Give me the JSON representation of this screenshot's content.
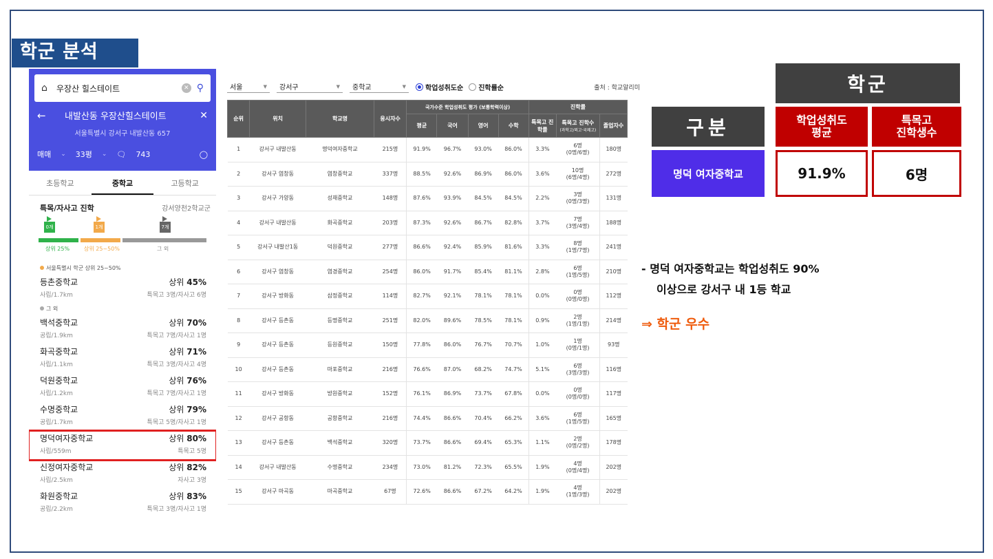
{
  "slide": {
    "title": "학군 분석"
  },
  "app": {
    "search": {
      "query": "우장산 힐스테이트"
    },
    "header": {
      "name": "내발산동 우장산힐스테이트",
      "address": "서울특별시 강서구 내발산동 657"
    },
    "meta": {
      "deal": "매매",
      "size": "33평",
      "comments": "743"
    },
    "tabs": [
      "초등학교",
      "중학교",
      "고등학교"
    ],
    "special": {
      "title": "특목/자사고 진학",
      "right": "강서양천2학교군"
    },
    "flags": [
      {
        "label": "0개",
        "color": "#2fb24a"
      },
      {
        "label": "1개",
        "color": "#f2a94a"
      },
      {
        "label": "7개",
        "color": "#666666"
      }
    ],
    "bar_labels": [
      "상위 25%",
      "상위 25~50%",
      "그 외"
    ],
    "bar_fractions": [
      0.22,
      0.22,
      0.56
    ],
    "group1_caption": "서울특별시 학군 상위 25~50%",
    "group2_caption": "그 외",
    "schools_group1": [
      {
        "name": "등촌중학교",
        "rank_prefix": "상위 ",
        "rank": "45%",
        "sub": "사립/1.7km",
        "sub2": "특목고 3명/자사고 6명"
      }
    ],
    "schools_group2": [
      {
        "name": "백석중학교",
        "rank_prefix": "상위 ",
        "rank": "70%",
        "sub": "공립/1.9km",
        "sub2": "특목고 7명/자사고 1명"
      },
      {
        "name": "화곡중학교",
        "rank_prefix": "상위 ",
        "rank": "71%",
        "sub": "사립/1.1km",
        "sub2": "특목고 3명/자사고 4명"
      },
      {
        "name": "덕원중학교",
        "rank_prefix": "상위 ",
        "rank": "76%",
        "sub": "사립/1.2km",
        "sub2": "특목고 7명/자사고 1명"
      },
      {
        "name": "수명중학교",
        "rank_prefix": "상위 ",
        "rank": "79%",
        "sub": "공립/1.7km",
        "sub2": "특목고 5명/자사고 1명"
      },
      {
        "name": "명덕여자중학교",
        "rank_prefix": "상위 ",
        "rank": "80%",
        "sub": "사립/559m",
        "sub2": "특목고 5명",
        "highlight": true
      },
      {
        "name": "신정여자중학교",
        "rank_prefix": "상위 ",
        "rank": "82%",
        "sub": "사립/2.5km",
        "sub2": "자사고 3명"
      },
      {
        "name": "화원중학교",
        "rank_prefix": "상위 ",
        "rank": "83%",
        "sub": "공립/2.2km",
        "sub2": "특목고 3명/자사고 1명"
      }
    ]
  },
  "filters": {
    "city": "서울",
    "district": "강서구",
    "level": "중학교",
    "sort1": "학업성취도순",
    "sort2": "진학률순",
    "source": "출처 : 학교알리미"
  },
  "table": {
    "header_top": [
      "순위",
      "위치",
      "학교명",
      "응시자수",
      "국가수준 학업성취도 평가 (보통학력이상)",
      "진학률"
    ],
    "header_sub": [
      "평균",
      "국어",
      "영어",
      "수학",
      "특목고 진학률",
      "특목고 진학수",
      "(과학고/외고·국제고)",
      "졸업자수"
    ],
    "rows": [
      [
        "1",
        "강서구 내발산동",
        "명덕여자중학교",
        "215명",
        "91.9%",
        "96.7%",
        "93.0%",
        "86.0%",
        "3.3%",
        "6명",
        "(0명/6명)",
        "180명"
      ],
      [
        "2",
        "강서구 염창동",
        "염창중학교",
        "337명",
        "88.5%",
        "92.6%",
        "86.9%",
        "86.0%",
        "3.6%",
        "10명",
        "(6명/4명)",
        "272명"
      ],
      [
        "3",
        "강서구 가양동",
        "성재중학교",
        "148명",
        "87.6%",
        "93.9%",
        "84.5%",
        "84.5%",
        "2.2%",
        "3명",
        "(0명/3명)",
        "131명"
      ],
      [
        "4",
        "강서구 내발산동",
        "화곡중학교",
        "203명",
        "87.3%",
        "92.6%",
        "86.7%",
        "82.8%",
        "3.7%",
        "7명",
        "(3명/4명)",
        "188명"
      ],
      [
        "5",
        "강서구 내발산1동",
        "덕원중학교",
        "277명",
        "86.6%",
        "92.4%",
        "85.9%",
        "81.6%",
        "3.3%",
        "8명",
        "(1명/7명)",
        "241명"
      ],
      [
        "6",
        "강서구 염창동",
        "염경중학교",
        "254명",
        "86.0%",
        "91.7%",
        "85.4%",
        "81.1%",
        "2.8%",
        "6명",
        "(1명/5명)",
        "210명"
      ],
      [
        "7",
        "강서구 방화동",
        "삼정중학교",
        "114명",
        "82.7%",
        "92.1%",
        "78.1%",
        "78.1%",
        "0.0%",
        "0명",
        "(0명/0명)",
        "112명"
      ],
      [
        "8",
        "강서구 등촌동",
        "등명중학교",
        "251명",
        "82.0%",
        "89.6%",
        "78.5%",
        "78.1%",
        "0.9%",
        "2명",
        "(1명/1명)",
        "214명"
      ],
      [
        "9",
        "강서구 등촌동",
        "등원중학교",
        "150명",
        "77.8%",
        "86.0%",
        "76.7%",
        "70.7%",
        "1.0%",
        "1명",
        "(0명/1명)",
        "93명"
      ],
      [
        "10",
        "강서구 등촌동",
        "마포중학교",
        "216명",
        "76.6%",
        "87.0%",
        "68.2%",
        "74.7%",
        "5.1%",
        "6명",
        "(3명/3명)",
        "116명"
      ],
      [
        "11",
        "강서구 방화동",
        "방원중학교",
        "152명",
        "76.1%",
        "86.9%",
        "73.7%",
        "67.8%",
        "0.0%",
        "0명",
        "(0명/0명)",
        "117명"
      ],
      [
        "12",
        "강서구 공항동",
        "공항중학교",
        "216명",
        "74.4%",
        "86.6%",
        "70.4%",
        "66.2%",
        "3.6%",
        "6명",
        "(1명/5명)",
        "165명"
      ],
      [
        "13",
        "강서구 등촌동",
        "백석중학교",
        "320명",
        "73.7%",
        "86.6%",
        "69.4%",
        "65.3%",
        "1.1%",
        "2명",
        "(0명/2명)",
        "178명"
      ],
      [
        "14",
        "강서구 내발산동",
        "수명중학교",
        "234명",
        "73.0%",
        "81.2%",
        "72.3%",
        "65.5%",
        "1.9%",
        "4명",
        "(0명/4명)",
        "202명"
      ],
      [
        "15",
        "강서구 마곡동",
        "마곡중학교",
        "67명",
        "72.6%",
        "86.6%",
        "67.2%",
        "64.2%",
        "1.9%",
        "4명",
        "(1명/3명)",
        "202명"
      ]
    ]
  },
  "summary": {
    "school_header": "학군",
    "gubun": "구분",
    "avg_header_1": "학업성취도",
    "avg_header_2": "평균",
    "spec_header_1": "특목고",
    "spec_header_2": "진학생수",
    "school_name": "명덕 여자중학교",
    "avg_value": "91.9%",
    "spec_value": "6명"
  },
  "note": {
    "line1": "- 명덕 여자중학교는 학업성취도 90%",
    "line2": "이상으로 강서구 내 1등 학교",
    "verdict": "⇒ 학군 우수"
  }
}
